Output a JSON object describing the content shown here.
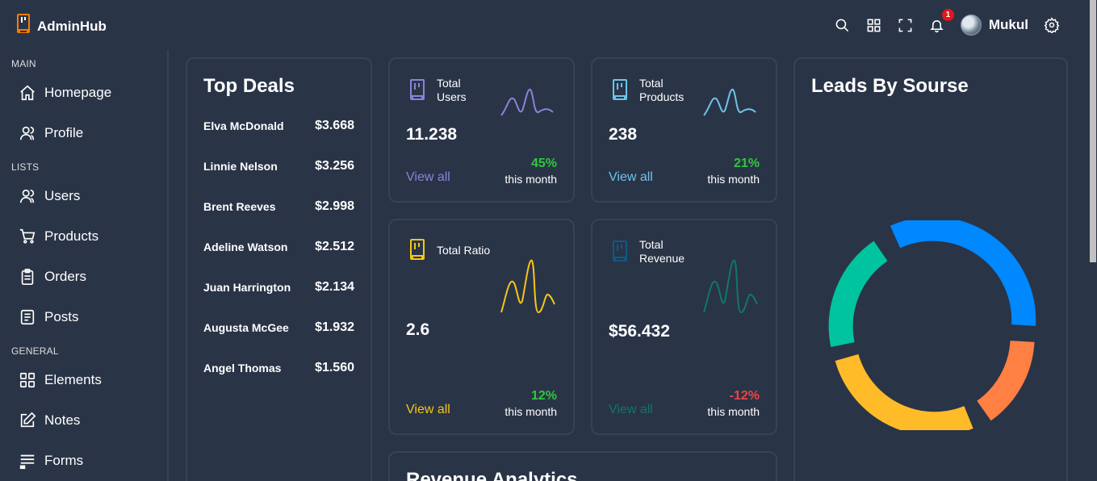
{
  "app": {
    "name": "AdminHub"
  },
  "navbar": {
    "notification_count": "1",
    "username": "Mukul",
    "icons": [
      "search-icon",
      "apps-icon",
      "fullscreen-icon",
      "bell-icon",
      "settings-icon"
    ]
  },
  "sidebar": {
    "sections": [
      {
        "title": "MAIN",
        "items": [
          {
            "label": "Homepage",
            "icon": "home-icon"
          },
          {
            "label": "Profile",
            "icon": "user-icon"
          }
        ]
      },
      {
        "title": "LISTS",
        "items": [
          {
            "label": "Users",
            "icon": "users-icon"
          },
          {
            "label": "Products",
            "icon": "cart-icon"
          },
          {
            "label": "Orders",
            "icon": "clipboard-icon"
          },
          {
            "label": "Posts",
            "icon": "posts-icon"
          }
        ]
      },
      {
        "title": "GENERAL",
        "items": [
          {
            "label": "Elements",
            "icon": "grid-icon"
          },
          {
            "label": "Notes",
            "icon": "note-edit-icon"
          },
          {
            "label": "Forms",
            "icon": "forms-icon"
          }
        ]
      }
    ]
  },
  "top_deals": {
    "title": "Top Deals",
    "deals": [
      {
        "name": "Elva McDonald",
        "amount": "$3.668"
      },
      {
        "name": "Linnie Nelson",
        "amount": "$3.256"
      },
      {
        "name": "Brent Reeves",
        "amount": "$2.998"
      },
      {
        "name": "Adeline Watson",
        "amount": "$2.512"
      },
      {
        "name": "Juan Harrington",
        "amount": "$2.134"
      },
      {
        "name": "Augusta McGee",
        "amount": "$1.932"
      },
      {
        "name": "Angel Thomas",
        "amount": "$1.560"
      }
    ]
  },
  "stats": {
    "users": {
      "title_line1": "Total",
      "title_line2": "Users",
      "value": "11.238",
      "link": "View all",
      "percent": "45%",
      "period": "this month",
      "color": "#8884d8",
      "percent_color": "#2fc73d"
    },
    "products": {
      "title_line1": "Total",
      "title_line2": "Products",
      "value": "238",
      "link": "View all",
      "percent": "21%",
      "period": "this month",
      "color": "#6ec4e8",
      "percent_color": "#2fc73d"
    },
    "ratio": {
      "title": "Total Ratio",
      "value": "2.6",
      "link": "View all",
      "percent": "12%",
      "period": "this month",
      "color": "#f5c518",
      "percent_color": "#2fc73d"
    },
    "revenue": {
      "title_line1": "Total",
      "title_line2": "Revenue",
      "value": "$56.432",
      "link": "View all",
      "percent": "-12%",
      "period": "this month",
      "color": "#0f766e",
      "percent_color": "#ef4444"
    }
  },
  "leads": {
    "title": "Leads By Sourse",
    "segment_colors": [
      "#0088fe",
      "#ff8042",
      "#ffbb28",
      "#00c49f"
    ]
  },
  "revenue_analytics": {
    "title": "Revenue Analytics"
  }
}
